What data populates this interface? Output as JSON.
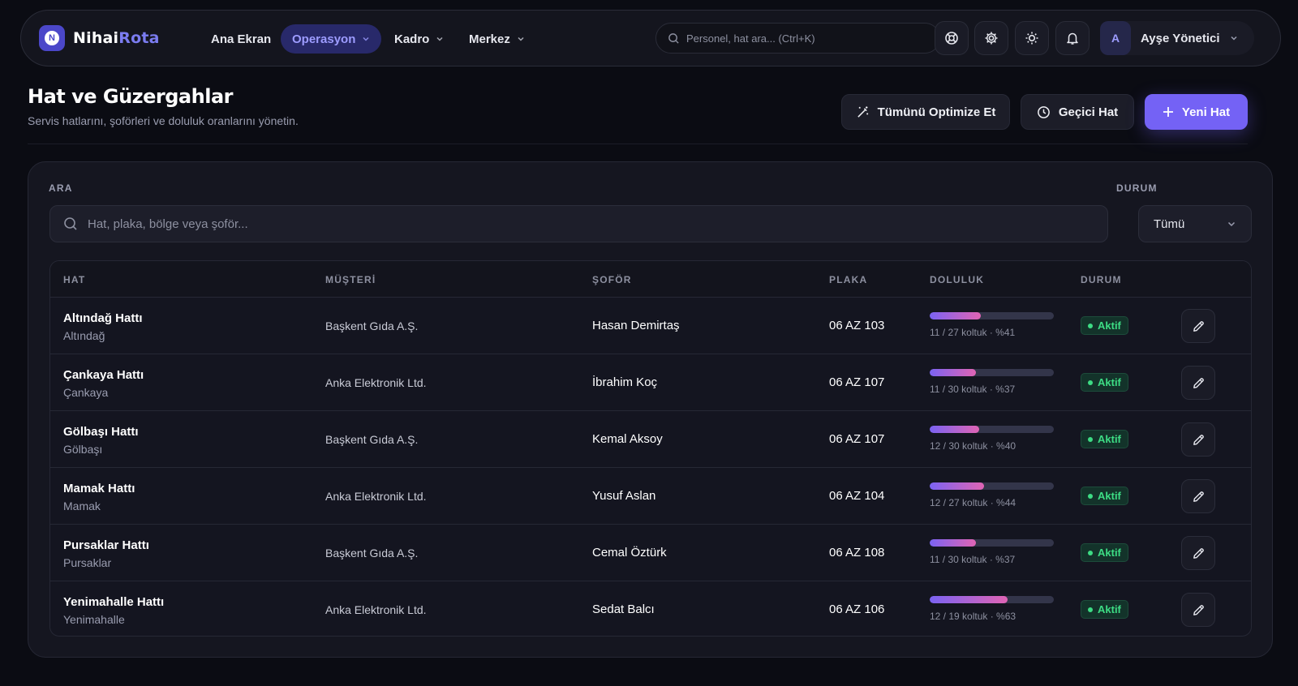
{
  "app": {
    "brand_part1": "Nihai",
    "brand_part2": "Rota",
    "logo_letter": "N"
  },
  "nav": {
    "items": [
      {
        "label": "Ana Ekran",
        "active": false
      },
      {
        "label": "Operasyon",
        "active": true
      },
      {
        "label": "Kadro",
        "active": false
      },
      {
        "label": "Merkez",
        "active": false
      }
    ],
    "search_placeholder": "Personel, hat ara...  (Ctrl+K)",
    "icons": [
      "support-icon",
      "gear-icon",
      "sun-icon",
      "bell-icon"
    ],
    "user": {
      "initial": "A",
      "name": "Ayşe Yönetici"
    }
  },
  "header": {
    "title": "Hat ve Güzergahlar",
    "subtitle": "Servis hatlarını, şoförleri ve doluluk oranlarını yönetin.",
    "btn_optimize": "Tümünü Optimize Et",
    "btn_temp": "Geçici Hat",
    "btn_new": "Yeni Hat"
  },
  "filters": {
    "search_label": "ARA",
    "search_placeholder": "Hat, plaka, bölge veya şoför...",
    "status_label": "DURUM",
    "status_value": "Tümü"
  },
  "table": {
    "columns": [
      "HAT",
      "MÜŞTERİ",
      "ŞOFÖR",
      "PLAKA",
      "DOLULUK",
      "DURUM"
    ],
    "rows": [
      {
        "name": "Altındağ Hattı",
        "region": "Altındağ",
        "customer": "Başkent Gıda A.Ş.",
        "driver": "Hasan Demirtaş",
        "plate": "06 AZ 103",
        "occupancy": 0.41,
        "occupancy_text": "11 / 27 koltuk · %41",
        "status": "Aktif"
      },
      {
        "name": "Çankaya Hattı",
        "region": "Çankaya",
        "customer": "Anka Elektronik Ltd.",
        "driver": "İbrahim Koç",
        "plate": "06 AZ 107",
        "occupancy": 0.37,
        "occupancy_text": "11 / 30 koltuk · %37",
        "status": "Aktif"
      },
      {
        "name": "Gölbaşı Hattı",
        "region": "Gölbaşı",
        "customer": "Başkent Gıda A.Ş.",
        "driver": "Kemal Aksoy",
        "plate": "06 AZ 107",
        "occupancy": 0.4,
        "occupancy_text": "12 / 30 koltuk · %40",
        "status": "Aktif"
      },
      {
        "name": "Mamak Hattı",
        "region": "Mamak",
        "customer": "Anka Elektronik Ltd.",
        "driver": "Yusuf Aslan",
        "plate": "06 AZ 104",
        "occupancy": 0.44,
        "occupancy_text": "12 / 27 koltuk · %44",
        "status": "Aktif"
      },
      {
        "name": "Pursaklar Hattı",
        "region": "Pursaklar",
        "customer": "Başkent Gıda A.Ş.",
        "driver": "Cemal Öztürk",
        "plate": "06 AZ 108",
        "occupancy": 0.37,
        "occupancy_text": "11 / 30 koltuk · %37",
        "status": "Aktif"
      },
      {
        "name": "Yenimahalle Hattı",
        "region": "Yenimahalle",
        "customer": "Anka Elektronik Ltd.",
        "driver": "Sedat Balcı",
        "plate": "06 AZ 106",
        "occupancy": 0.63,
        "occupancy_text": "12 / 19 koltuk · %63",
        "status": "Aktif"
      }
    ]
  },
  "colors": {
    "accent": "#7462f5",
    "status_active": "#3ddc84",
    "background": "#0b0c13"
  }
}
